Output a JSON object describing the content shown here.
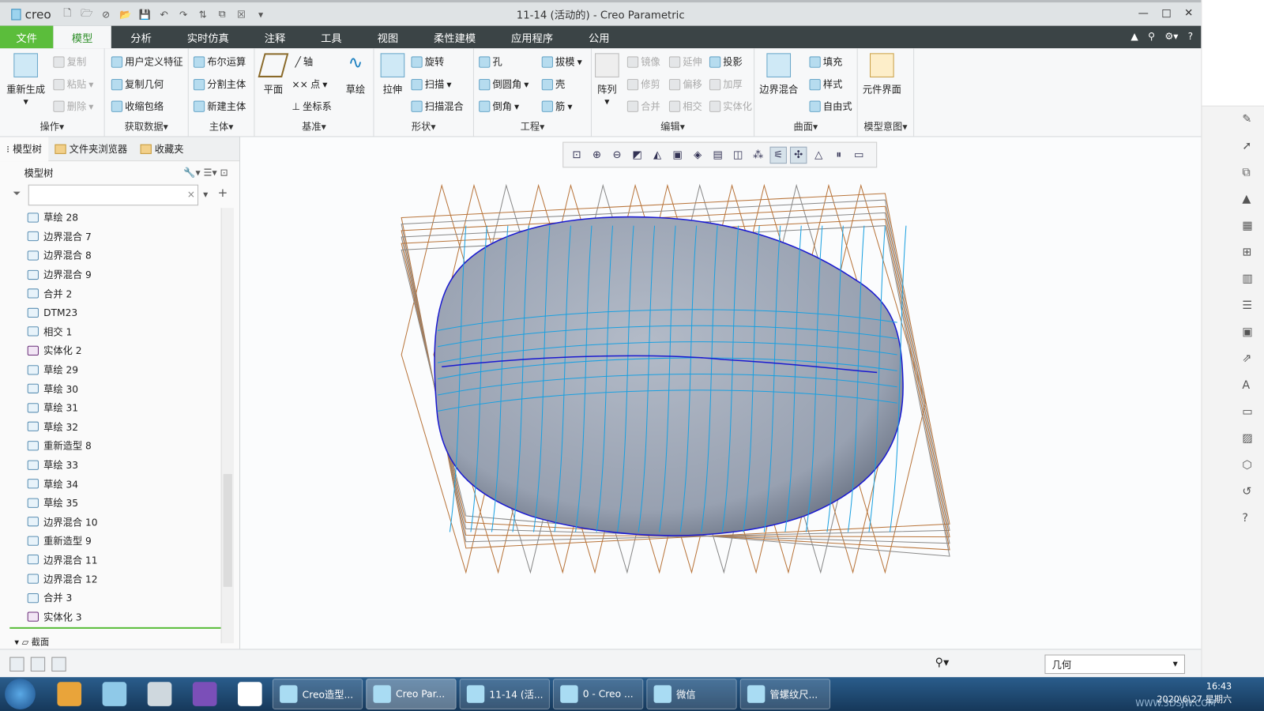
{
  "window": {
    "logo": "creo",
    "title": "11-14 (活动的) - Creo Parametric",
    "minimize": "—",
    "maximize": "□",
    "close": "✕"
  },
  "tabs": [
    {
      "label": "文件"
    },
    {
      "label": "模型"
    },
    {
      "label": "分析"
    },
    {
      "label": "实时仿真"
    },
    {
      "label": "注释"
    },
    {
      "label": "工具"
    },
    {
      "label": "视图"
    },
    {
      "label": "柔性建模"
    },
    {
      "label": "应用程序"
    },
    {
      "label": "公用"
    }
  ],
  "ribbon": {
    "operations": {
      "label": "操作",
      "regenerate": "重新生成",
      "copy": "复制",
      "paste": "粘贴",
      "delete": "删除"
    },
    "get_data": {
      "label": "获取数据",
      "udf": "用户定义特征",
      "copy_geom": "复制几何",
      "shrinkwrap": "收缩包络"
    },
    "body": {
      "label": "主体",
      "boolean": "布尔运算",
      "split": "分割主体",
      "new": "新建主体"
    },
    "datum": {
      "label": "基准",
      "plane": "平面",
      "axis": "轴",
      "point": "点",
      "csys": "坐标系",
      "sketch": "草绘"
    },
    "shapes": {
      "label": "形状",
      "extrude": "拉伸",
      "revolve": "旋转",
      "sweep": "扫描",
      "swept_blend": "扫描混合"
    },
    "engineering": {
      "label": "工程",
      "hole": "孔",
      "round": "倒圆角",
      "chamfer": "倒角",
      "draft": "拔模",
      "shell": "壳",
      "rib": "筋"
    },
    "editing": {
      "label": "编辑",
      "pattern": "阵列",
      "mirror": "镜像",
      "extend": "延伸",
      "project": "投影",
      "trim": "修剪",
      "offset": "偏移",
      "thicken": "加厚",
      "merge": "合并",
      "intersect": "相交",
      "solidify": "实体化"
    },
    "surfaces": {
      "label": "曲面",
      "boundary": "边界混合",
      "fill": "填充",
      "style": "样式",
      "freestyle": "自由式"
    },
    "intent": {
      "label": "模型意图",
      "component_interface": "元件界面"
    }
  },
  "panel": {
    "tabs": [
      {
        "label": "模型树"
      },
      {
        "label": "文件夹浏览器"
      },
      {
        "label": "收藏夹"
      }
    ],
    "header": "模型树",
    "search_placeholder": "",
    "items": [
      {
        "label": "草绘 28",
        "type": "sketch"
      },
      {
        "label": "边界混合 7",
        "type": "blend"
      },
      {
        "label": "边界混合 8",
        "type": "blend"
      },
      {
        "label": "边界混合 9",
        "type": "blend"
      },
      {
        "label": "合并 2",
        "type": "merge"
      },
      {
        "label": "DTM23",
        "type": "plane"
      },
      {
        "label": "相交 1",
        "type": "intersect"
      },
      {
        "label": "实体化 2",
        "type": "solidify"
      },
      {
        "label": "草绘 29",
        "type": "sketch"
      },
      {
        "label": "草绘 30",
        "type": "sketch"
      },
      {
        "label": "草绘 31",
        "type": "sketch"
      },
      {
        "label": "草绘 32",
        "type": "sketch"
      },
      {
        "label": "重新造型 8",
        "type": "restyle"
      },
      {
        "label": "草绘 33",
        "type": "sketch"
      },
      {
        "label": "草绘 34",
        "type": "sketch"
      },
      {
        "label": "草绘 35",
        "type": "sketch"
      },
      {
        "label": "边界混合 10",
        "type": "blend"
      },
      {
        "label": "重新造型 9",
        "type": "restyle"
      },
      {
        "label": "边界混合 11",
        "type": "blend"
      },
      {
        "label": "边界混合 12",
        "type": "blend"
      },
      {
        "label": "合并 3",
        "type": "merge"
      },
      {
        "label": "实体化 3",
        "type": "solidify"
      }
    ],
    "footer_item": "截面"
  },
  "status": {
    "filter": "几何"
  },
  "taskbar": {
    "tasks": [
      {
        "label": "Creo造型..."
      },
      {
        "label": "Creo Par..."
      },
      {
        "label": "11-14 (活..."
      },
      {
        "label": "0 - Creo ..."
      },
      {
        "label": "微信"
      },
      {
        "label": "管螺纹尺..."
      }
    ],
    "time": "16:43",
    "date": "2020\\6\\27 星期六"
  },
  "watermark": "WWW.3DSJW.COM",
  "colors": {
    "file_tab": "#5bbd3b",
    "tab_bar": "#3b4446",
    "active_tab_text": "#2f8f2a",
    "surface": "#9aa3b3",
    "datum_orange": "#b8743a",
    "curve_blue": "#1aa0e0"
  }
}
